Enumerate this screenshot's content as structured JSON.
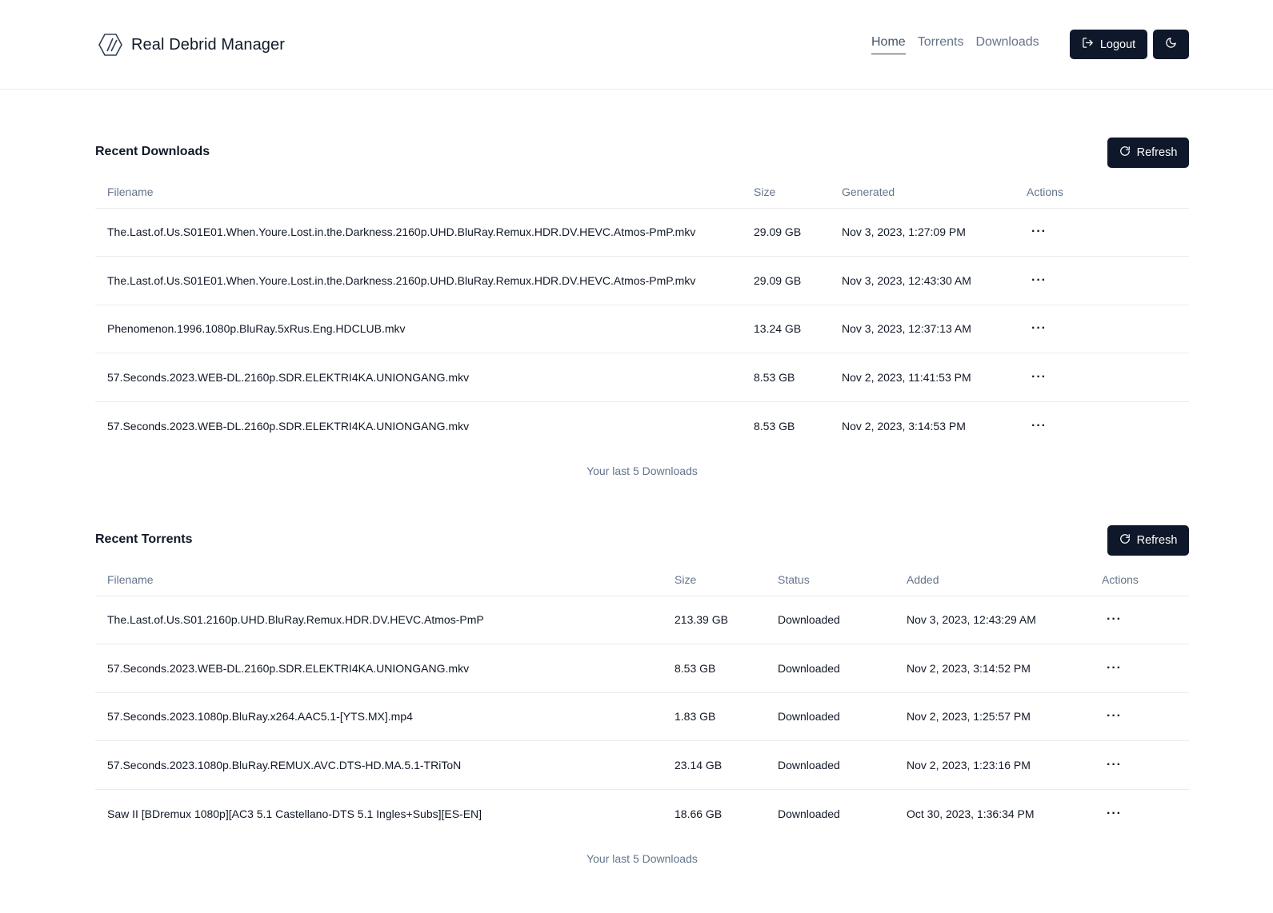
{
  "app": {
    "title": "Real Debrid Manager"
  },
  "nav": {
    "home": "Home",
    "torrents": "Torrents",
    "downloads": "Downloads"
  },
  "header": {
    "logout_label": "Logout"
  },
  "downloads": {
    "title": "Recent Downloads",
    "refresh_label": "Refresh",
    "columns": {
      "filename": "Filename",
      "size": "Size",
      "generated": "Generated",
      "actions": "Actions"
    },
    "rows": [
      {
        "filename": "The.Last.of.Us.S01E01.When.Youre.Lost.in.the.Darkness.2160p.UHD.BluRay.Remux.HDR.DV.HEVC.Atmos-PmP.mkv",
        "size": "29.09 GB",
        "generated": "Nov 3, 2023, 1:27:09 PM"
      },
      {
        "filename": "The.Last.of.Us.S01E01.When.Youre.Lost.in.the.Darkness.2160p.UHD.BluRay.Remux.HDR.DV.HEVC.Atmos-PmP.mkv",
        "size": "29.09 GB",
        "generated": "Nov 3, 2023, 12:43:30 AM"
      },
      {
        "filename": "Phenomenon.1996.1080p.BluRay.5xRus.Eng.HDCLUB.mkv",
        "size": "13.24 GB",
        "generated": "Nov 3, 2023, 12:37:13 AM"
      },
      {
        "filename": "57.Seconds.2023.WEB-DL.2160p.SDR.ELEKTRI4KA.UNIONGANG.mkv",
        "size": "8.53 GB",
        "generated": "Nov 2, 2023, 11:41:53 PM"
      },
      {
        "filename": "57.Seconds.2023.WEB-DL.2160p.SDR.ELEKTRI4KA.UNIONGANG.mkv",
        "size": "8.53 GB",
        "generated": "Nov 2, 2023, 3:14:53 PM"
      }
    ],
    "caption": "Your last 5 Downloads"
  },
  "torrents": {
    "title": "Recent Torrents",
    "refresh_label": "Refresh",
    "columns": {
      "filename": "Filename",
      "size": "Size",
      "status": "Status",
      "added": "Added",
      "actions": "Actions"
    },
    "rows": [
      {
        "filename": "The.Last.of.Us.S01.2160p.UHD.BluRay.Remux.HDR.DV.HEVC.Atmos-PmP",
        "size": "213.39 GB",
        "status": "Downloaded",
        "added": "Nov 3, 2023, 12:43:29 AM"
      },
      {
        "filename": "57.Seconds.2023.WEB-DL.2160p.SDR.ELEKTRI4KA.UNIONGANG.mkv",
        "size": "8.53 GB",
        "status": "Downloaded",
        "added": "Nov 2, 2023, 3:14:52 PM"
      },
      {
        "filename": "57.Seconds.2023.1080p.BluRay.x264.AAC5.1-[YTS.MX].mp4",
        "size": "1.83 GB",
        "status": "Downloaded",
        "added": "Nov 2, 2023, 1:25:57 PM"
      },
      {
        "filename": "57.Seconds.2023.1080p.BluRay.REMUX.AVC.DTS-HD.MA.5.1-TRiToN",
        "size": "23.14 GB",
        "status": "Downloaded",
        "added": "Nov 2, 2023, 1:23:16 PM"
      },
      {
        "filename": "Saw II [BDremux 1080p][AC3 5.1 Castellano-DTS 5.1 Ingles+Subs][ES-EN]",
        "size": "18.66 GB",
        "status": "Downloaded",
        "added": "Oct 30, 2023, 1:36:34 PM"
      }
    ],
    "caption": "Your last 5 Downloads"
  },
  "icons": {
    "logo": "slashes-logo-icon",
    "logout": "logout-icon",
    "theme": "moon-icon",
    "refresh": "refresh-icon",
    "row_actions": "more-horizontal-icon"
  },
  "colors": {
    "primary_button": "#0f172a",
    "muted_text": "#64748b",
    "border": "#e8eaee"
  }
}
